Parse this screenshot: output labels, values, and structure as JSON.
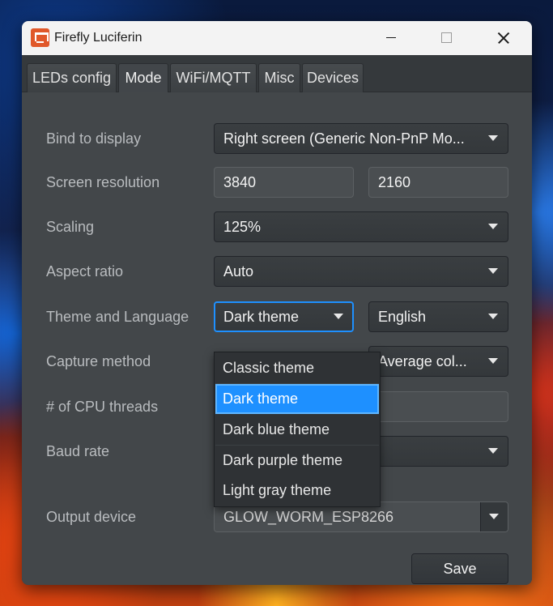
{
  "window": {
    "title": "Firefly Luciferin"
  },
  "tabs": [
    {
      "label": "LEDs config"
    },
    {
      "label": "Mode"
    },
    {
      "label": "WiFi/MQTT"
    },
    {
      "label": "Misc"
    },
    {
      "label": "Devices"
    }
  ],
  "active_tab": "Mode",
  "form": {
    "bind_to_display": {
      "label": "Bind to display",
      "value": "Right screen (Generic Non-PnP Mo..."
    },
    "screen_resolution": {
      "label": "Screen resolution",
      "width": "3840",
      "height": "2160"
    },
    "scaling": {
      "label": "Scaling",
      "value": "125%"
    },
    "aspect_ratio": {
      "label": "Aspect ratio",
      "value": "Auto"
    },
    "theme_language": {
      "label": "Theme and Language",
      "theme": "Dark theme",
      "language": "English"
    },
    "capture_method": {
      "label": "Capture method",
      "value": "Average col..."
    },
    "cpu_threads": {
      "label": "# of CPU threads",
      "value": ""
    },
    "baud_rate": {
      "label": "Baud rate",
      "value": ""
    },
    "output_device": {
      "label": "Output device",
      "value": "GLOW_WORM_ESP8266"
    },
    "save_label": "Save"
  },
  "theme_dropdown": {
    "options": [
      "Classic theme",
      "Dark theme",
      "Dark blue theme",
      "Dark purple theme",
      "Light gray theme"
    ],
    "selected": "Dark theme"
  },
  "colors": {
    "accent": "#1e90ff",
    "window_bg": "#43474a",
    "titlebar_bg": "#f3f3f3"
  }
}
